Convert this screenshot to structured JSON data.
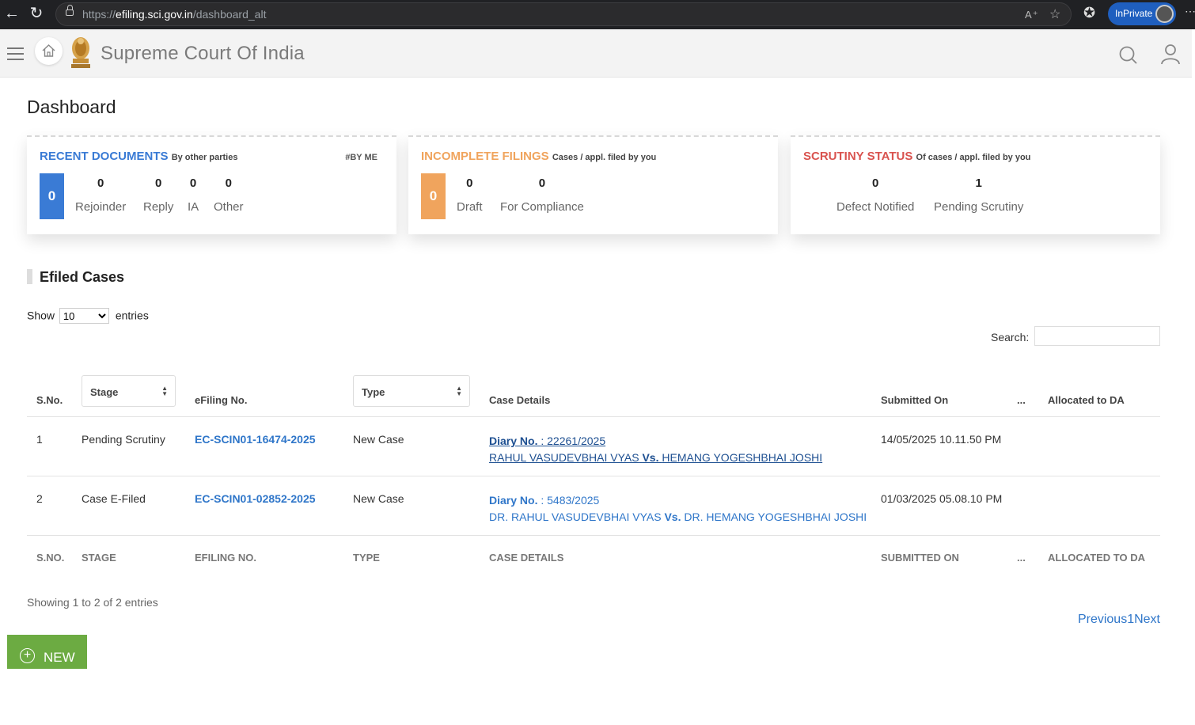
{
  "browser": {
    "url_prefix": "https://",
    "url_host": "efiling.sci.gov.in",
    "url_path": "/dashboard_alt",
    "inprivate_label": "InPrivate"
  },
  "header": {
    "title": "Supreme Court Of India"
  },
  "page": {
    "title": "Dashboard"
  },
  "cards": {
    "recent": {
      "title": "RECENT DOCUMENTS",
      "subtitle": "By other parties",
      "tag": "#BY ME",
      "total": "0",
      "stats": [
        {
          "value": "0",
          "label": "Rejoinder"
        },
        {
          "value": "0",
          "label": "Reply"
        },
        {
          "value": "0",
          "label": "IA"
        },
        {
          "value": "0",
          "label": "Other"
        }
      ]
    },
    "incomplete": {
      "title": "INCOMPLETE FILINGS",
      "subtitle": "Cases / appl. filed by you",
      "total": "0",
      "stats": [
        {
          "value": "0",
          "label": "Draft"
        },
        {
          "value": "0",
          "label": "For Compliance"
        }
      ]
    },
    "scrutiny": {
      "title": "SCRUTINY STATUS",
      "subtitle": "Of cases / appl. filed by you",
      "stats": [
        {
          "value": "0",
          "label": "Defect Notified"
        },
        {
          "value": "1",
          "label": "Pending Scrutiny"
        }
      ]
    }
  },
  "colors": {
    "recent": "#3a7bd5",
    "incomplete": "#f0a45d",
    "scrutiny": "#d9534f",
    "new_button": "#6cab42",
    "link": "#2f76c9"
  },
  "efiled": {
    "section_title": "Efiled Cases",
    "show_label": "Show",
    "entries_value": "10",
    "entries_label": "entries",
    "search_label": "Search:",
    "headers": {
      "sno": "S.No.",
      "stage": "Stage",
      "efiling_no": "eFiling No.",
      "type": "Type",
      "case_details": "Case Details",
      "submitted_on": "Submitted On",
      "ellipsis": "...",
      "allocated": "Allocated to DA"
    },
    "rows": [
      {
        "sno": "1",
        "stage": "Pending Scrutiny",
        "efiling_no": "EC-SCIN01-16474-2025",
        "type": "New Case",
        "diary_label": "Diary No.",
        "diary_no": ": 22261/2025",
        "petitioner": "RAHUL VASUDEVBHAI VYAS",
        "vs": "Vs.",
        "respondent": "HEMANG YOGESHBHAI JOSHI",
        "submitted_on": "14/05/2025 10.11.50 PM"
      },
      {
        "sno": "2",
        "stage": "Case E-Filed",
        "efiling_no": "EC-SCIN01-02852-2025",
        "type": "New Case",
        "diary_label": "Diary No.",
        "diary_no": ": 5483/2025",
        "petitioner": "DR. RAHUL VASUDEVBHAI VYAS",
        "vs": "Vs.",
        "respondent": "DR. HEMANG YOGESHBHAI JOSHI",
        "submitted_on": "01/03/2025 05.08.10 PM"
      }
    ],
    "footer": {
      "sno": "S.NO.",
      "stage": "STAGE",
      "efiling_no": "EFILING NO.",
      "type": "TYPE",
      "case_details": "CASE DETAILS",
      "submitted_on": "SUBMITTED ON",
      "ellipsis": "...",
      "allocated": "ALLOCATED TO DA"
    },
    "showing_text": "Showing 1 to 2 of 2 entries",
    "pager": {
      "previous": "Previous",
      "page": "1",
      "next": "Next"
    }
  },
  "new_button": {
    "label": "NEW"
  }
}
